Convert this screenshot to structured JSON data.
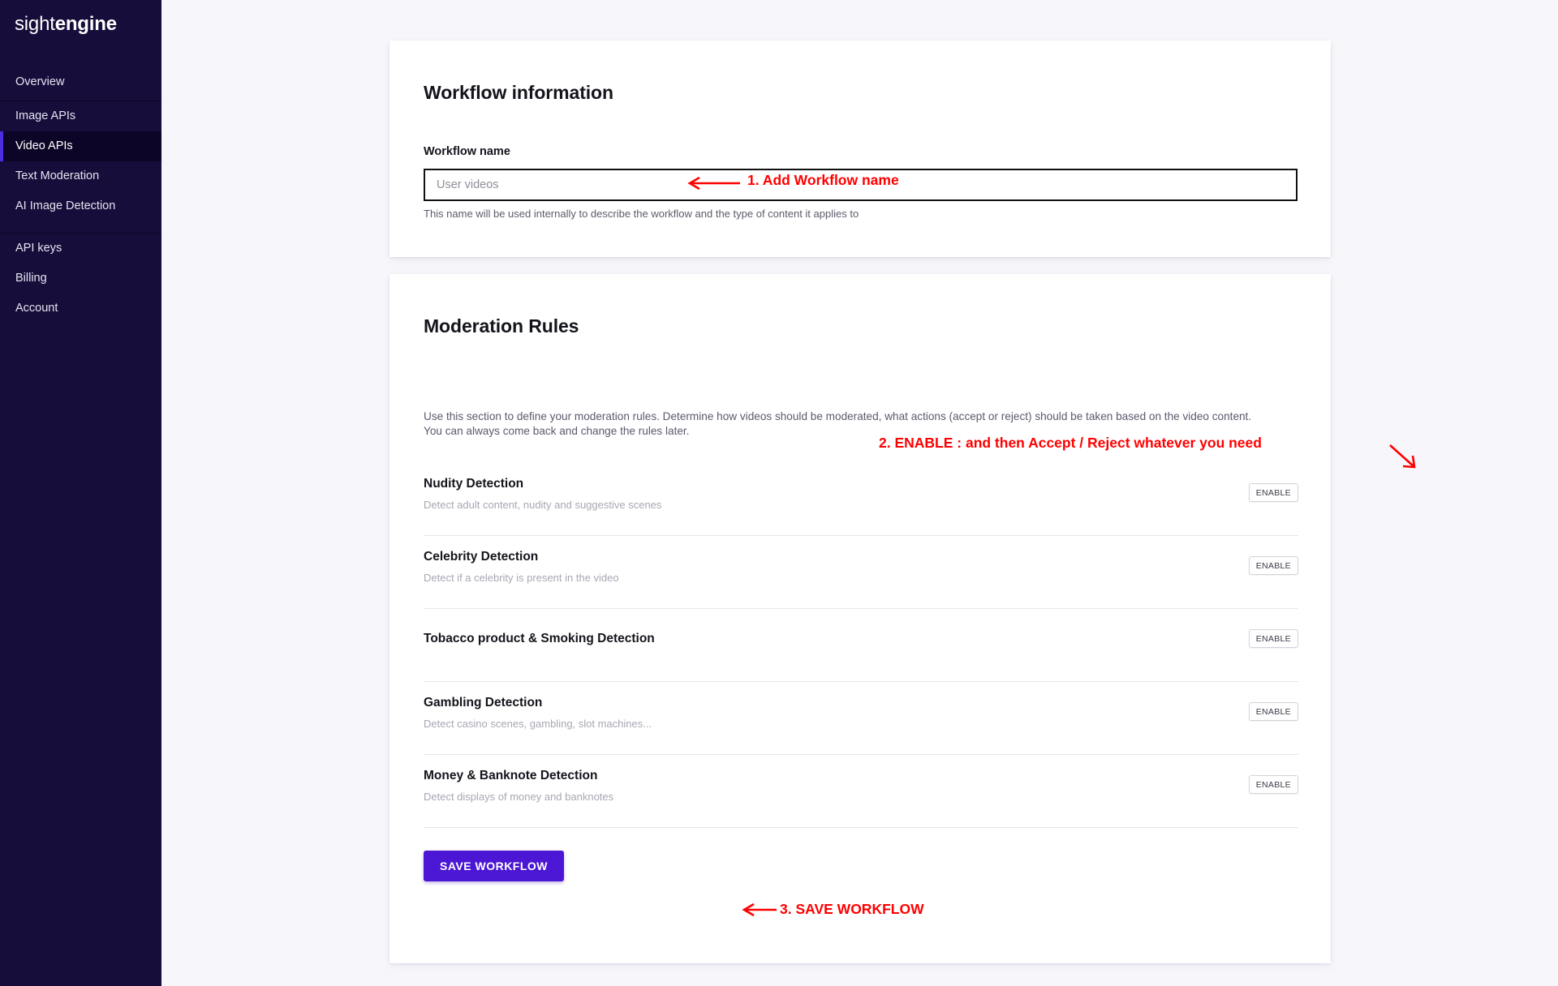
{
  "brand": {
    "name_light": "sight",
    "name_bold": "engine"
  },
  "sidebar": {
    "groups": [
      {
        "items": [
          {
            "label": "Overview",
            "active": false
          }
        ]
      },
      {
        "items": [
          {
            "label": "Image APIs",
            "active": false
          },
          {
            "label": "Video APIs",
            "active": true
          },
          {
            "label": "Text Moderation",
            "active": false
          },
          {
            "label": "AI Image Detection",
            "active": false
          }
        ]
      },
      {
        "items": [
          {
            "label": "API keys",
            "active": false
          },
          {
            "label": "Billing",
            "active": false
          },
          {
            "label": "Account",
            "active": false
          }
        ]
      }
    ]
  },
  "workflow_info": {
    "title": "Workflow information",
    "name_label": "Workflow name",
    "name_value": "",
    "name_placeholder": "User videos",
    "help_text": "This name will be used internally to describe the workflow and the type of content it applies to"
  },
  "moderation": {
    "title": "Moderation Rules",
    "description": "Use this section to define your moderation rules. Determine how videos should be moderated, what actions (accept or reject) should be taken based on the video content.\nYou can always come back and change the rules later.",
    "enable_label": "ENABLE",
    "rules": [
      {
        "title": "Nudity Detection",
        "subtitle": "Detect adult content, nudity and suggestive scenes"
      },
      {
        "title": "Celebrity Detection",
        "subtitle": "Detect if a celebrity is present in the video"
      },
      {
        "title": "Tobacco product & Smoking Detection",
        "subtitle": ""
      },
      {
        "title": "Gambling Detection",
        "subtitle": "Detect casino scenes, gambling, slot machines..."
      },
      {
        "title": "Money & Banknote Detection",
        "subtitle": "Detect displays of money and banknotes"
      }
    ],
    "save_label": "SAVE WORKFLOW"
  },
  "annotations": {
    "color": "#ff0000",
    "step1": "1.  Add Workflow name",
    "step2": "2. ENABLE : and then Accept / Reject whatever you need",
    "step3": "3. SAVE WORKFLOW"
  },
  "colors": {
    "sidebar_bg": "#160d3a",
    "sidebar_active_bg": "#0d0527",
    "accent": "#4b2ee0",
    "save_button": "#4b16d4",
    "page_bg": "#f7f7fb",
    "annotation_red": "#ff0000"
  }
}
